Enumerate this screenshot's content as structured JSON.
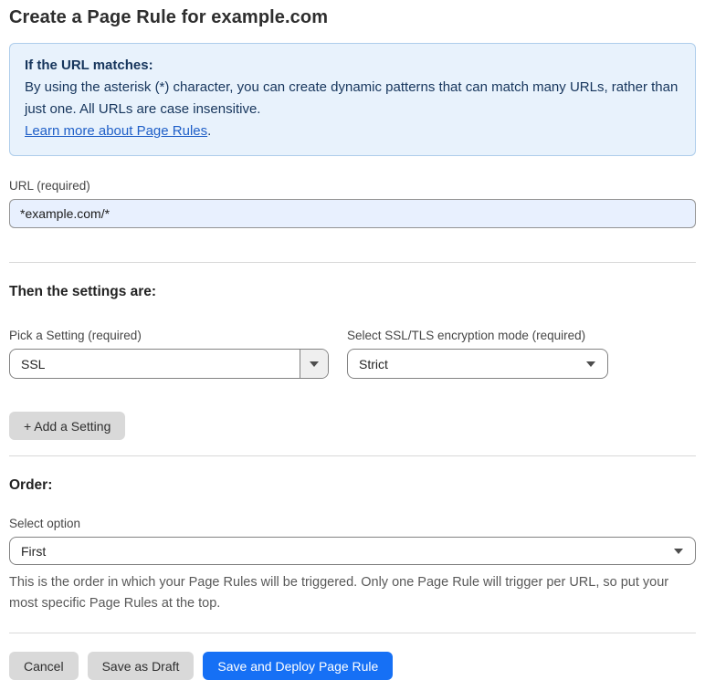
{
  "page": {
    "title": "Create a Page Rule for example.com"
  },
  "info_box": {
    "heading": "If the URL matches:",
    "body": "By using the asterisk (*) character, you can create dynamic patterns that can match many URLs, rather than just one. All URLs are case insensitive.",
    "link_label": "Learn more about Page Rules",
    "link_suffix": "."
  },
  "url_field": {
    "label": "URL (required)",
    "value": "*example.com/*"
  },
  "settings_section": {
    "heading": "Then the settings are:",
    "setting_picker": {
      "label": "Pick a Setting (required)",
      "value": "SSL"
    },
    "ssl_mode": {
      "label": "Select SSL/TLS encryption mode (required)",
      "value": "Strict"
    },
    "add_setting_label": "+ Add a Setting"
  },
  "order_section": {
    "heading": "Order:",
    "select_label": "Select option",
    "value": "First",
    "help_text": "This is the order in which your Page Rules will be triggered. Only one Page Rule will trigger per URL, so put your most specific Page Rules at the top."
  },
  "actions": {
    "cancel_label": "Cancel",
    "save_draft_label": "Save as Draft",
    "save_deploy_label": "Save and Deploy Page Rule"
  },
  "colors": {
    "accent_blue": "#1670f5",
    "info_box_bg": "#e8f2fc",
    "info_box_border": "#aecdeb",
    "info_text": "#16355c",
    "link_blue": "#2060c8",
    "url_input_bg": "#e8f0fe",
    "gray_button_bg": "#d9d9d9"
  },
  "icons": {
    "dropdown_arrow": "triangle-down"
  }
}
